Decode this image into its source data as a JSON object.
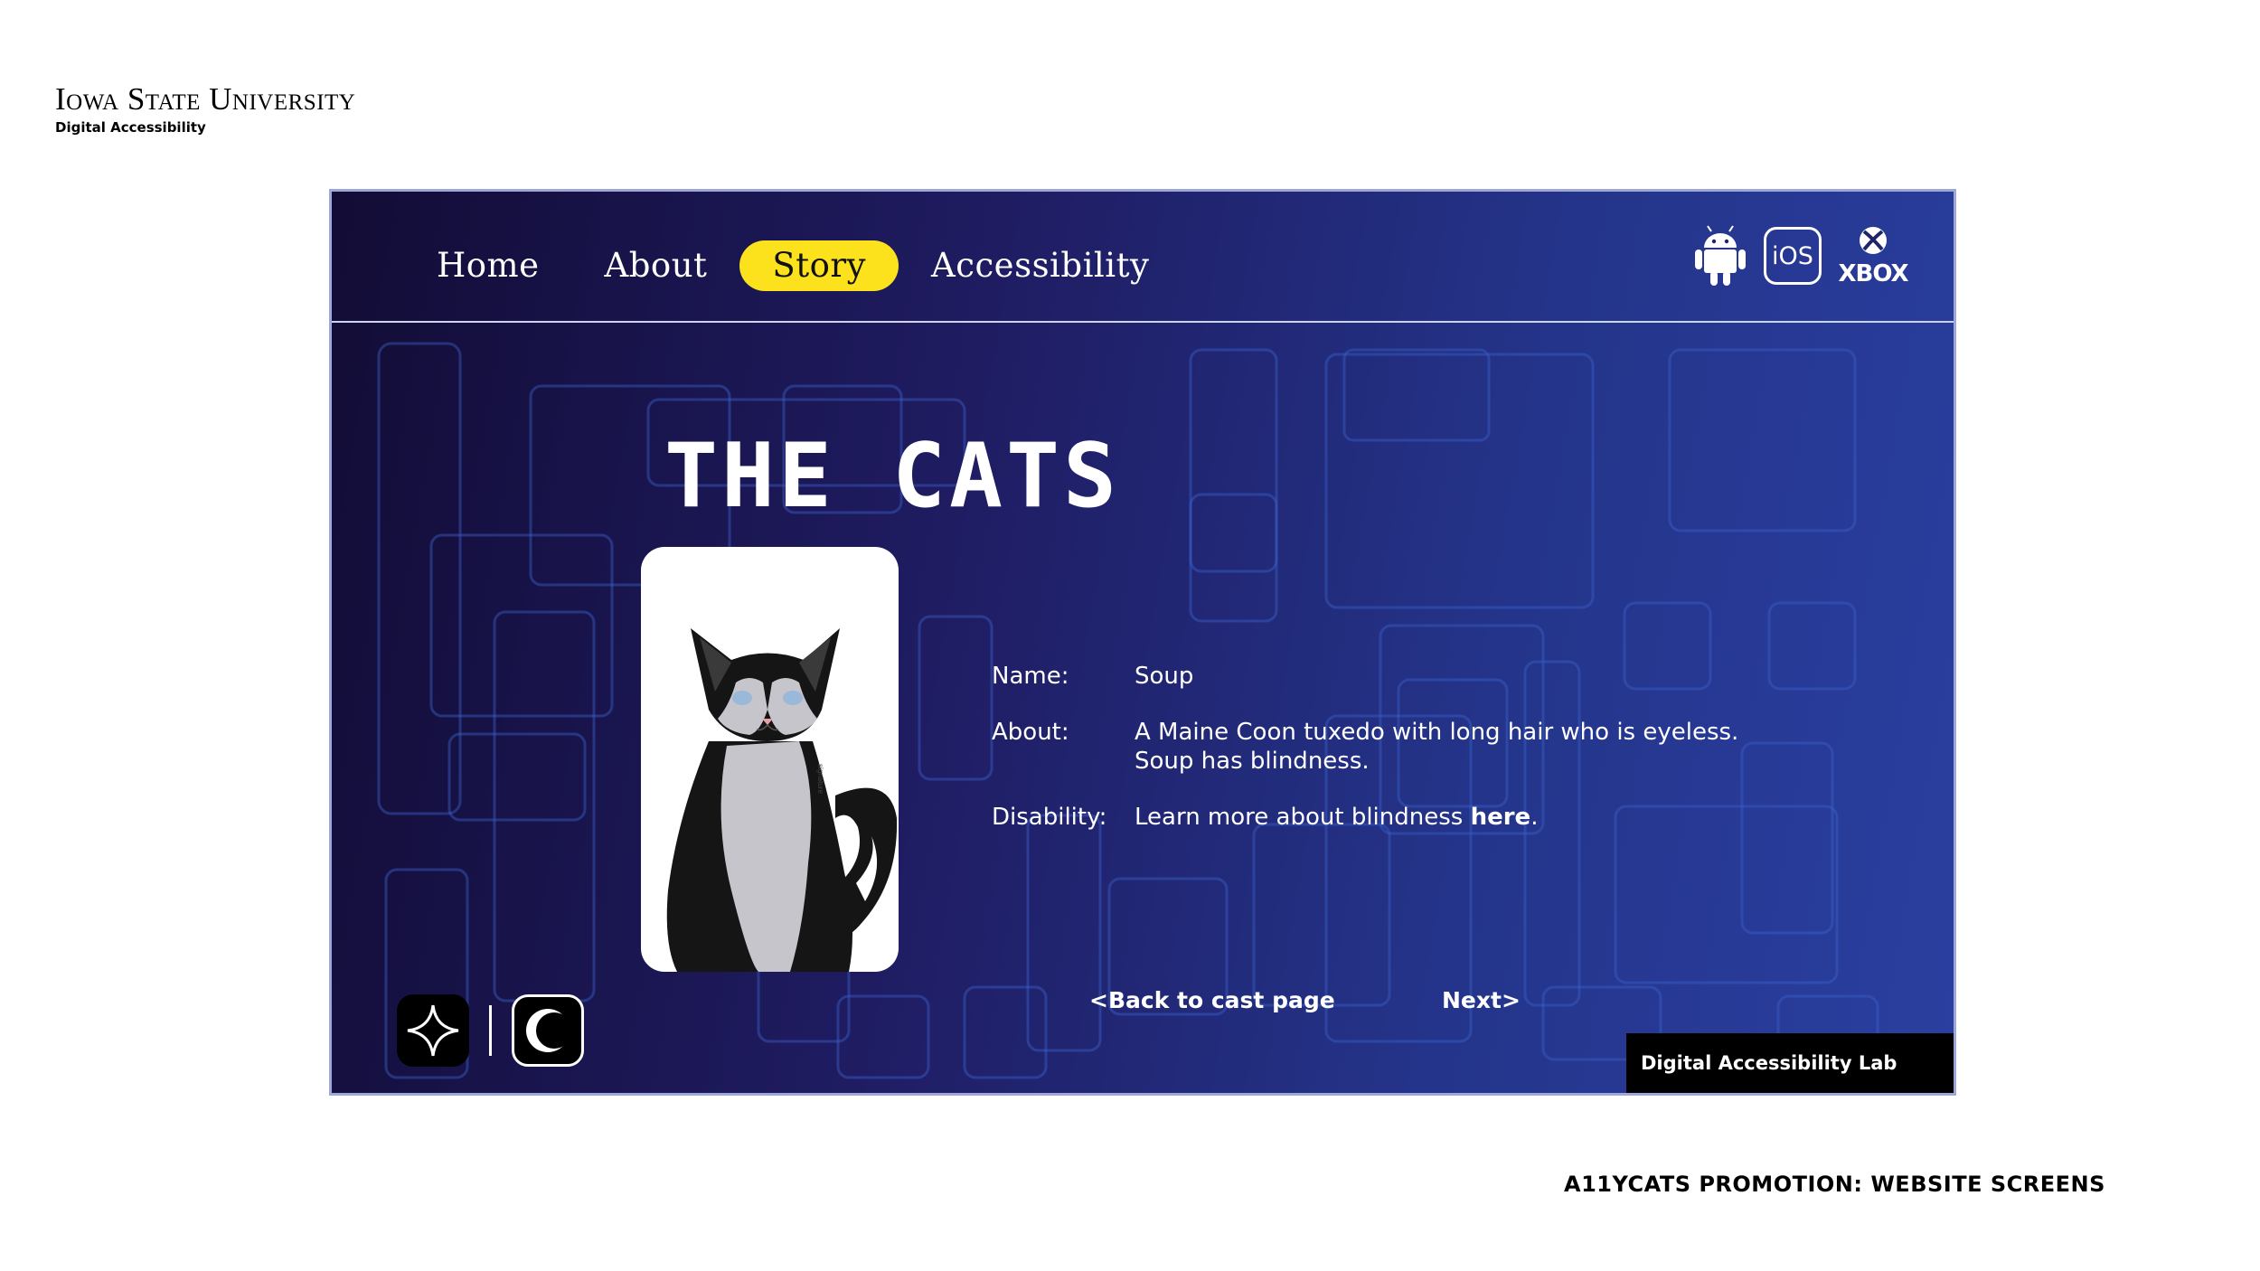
{
  "branding": {
    "university": "Iowa State University",
    "department": "Digital Accessibility"
  },
  "nav": {
    "links": [
      {
        "label": "Home",
        "active": false
      },
      {
        "label": "About",
        "active": false
      },
      {
        "label": "Story",
        "active": true
      },
      {
        "label": "Accessibility",
        "active": false
      }
    ],
    "platforms": {
      "android": "android-icon",
      "ios": "iOS",
      "xbox": "XBOX"
    }
  },
  "page": {
    "title": "THE CATS"
  },
  "cat": {
    "name_label": "Name:",
    "name": "Soup",
    "about_label": "About:",
    "about": "A Maine Coon tuxedo with long hair who is eyeless. Soup has blindness.",
    "disability_label": "Disability:",
    "disability_text": "Learn more about blindness ",
    "disability_link": "here",
    "disability_end": "."
  },
  "pager": {
    "back": "<Back to cast page",
    "next": "Next>"
  },
  "toggles": {
    "star": "sparkle-icon",
    "theme": "moon-icon"
  },
  "badge": "Digital Accessibility Lab",
  "caption": "A11YCATS PROMOTION: WEBSITE SCREENS",
  "colors": {
    "accent": "#fbe21d",
    "background_start": "#120c35",
    "background_end": "#2a3fa0"
  }
}
